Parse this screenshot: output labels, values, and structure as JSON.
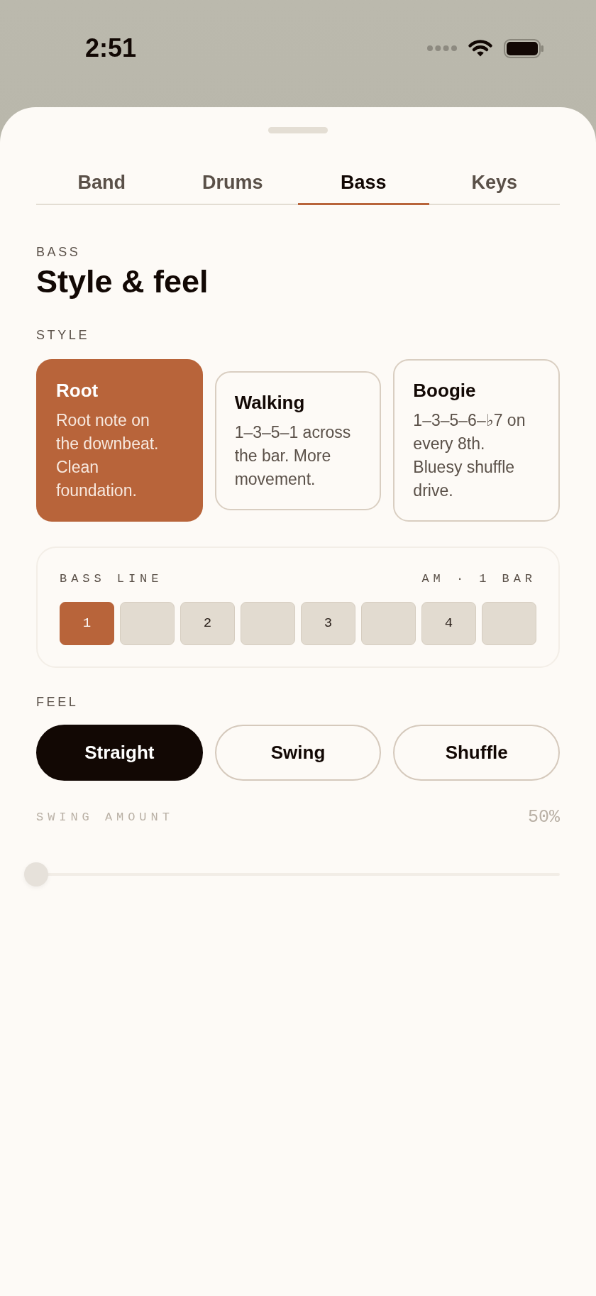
{
  "status_bar": {
    "time": "2:51"
  },
  "tabs": [
    {
      "label": "Band",
      "selected": false
    },
    {
      "label": "Drums",
      "selected": false
    },
    {
      "label": "Bass",
      "selected": true
    },
    {
      "label": "Keys",
      "selected": false
    }
  ],
  "header": {
    "eyebrow": "BASS",
    "title": "Style & feel"
  },
  "style": {
    "label": "STYLE",
    "options": [
      {
        "title": "Root",
        "description": "Root note on the downbeat. Clean foundation.",
        "selected": true
      },
      {
        "title": "Walking",
        "description": "1–3–5–1 across the bar. More movement.",
        "selected": false
      },
      {
        "title": "Boogie",
        "description": "1–3–5–6–♭7 on every 8th. Bluesy shuffle drive.",
        "selected": false
      }
    ]
  },
  "bass_line": {
    "label": "BASS LINE",
    "meta": "AM · 1 BAR",
    "steps": [
      {
        "label": "1",
        "selected": true
      },
      {
        "selected": false
      },
      {
        "label": "2",
        "selected": false
      },
      {
        "selected": false
      },
      {
        "label": "3",
        "selected": false
      },
      {
        "selected": false
      },
      {
        "label": "4",
        "selected": false
      },
      {
        "selected": false
      }
    ]
  },
  "feel": {
    "label": "FEEL",
    "options": [
      {
        "label": "Straight",
        "selected": true
      },
      {
        "label": "Swing",
        "selected": false
      },
      {
        "label": "Shuffle",
        "selected": false
      }
    ]
  },
  "swing_amount": {
    "label": "SWING AMOUNT",
    "reading": "50%",
    "disabled": true,
    "level": 0
  }
}
